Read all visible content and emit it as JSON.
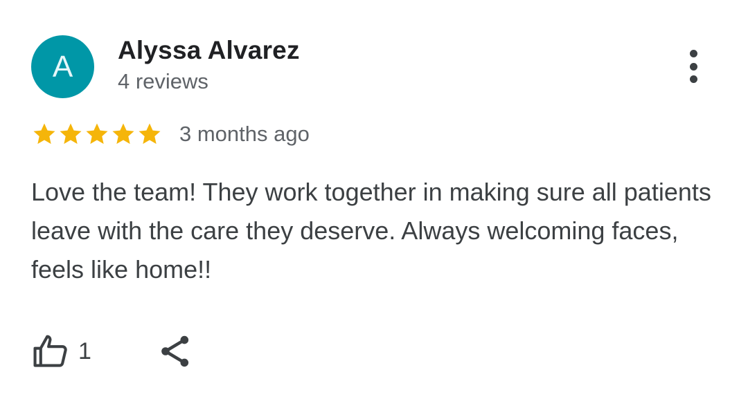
{
  "reviewer": {
    "avatar_initial": "A",
    "avatar_color": "#0097a7",
    "name": "Alyssa Alvarez",
    "review_count": "4 reviews"
  },
  "rating": {
    "stars": 5,
    "max_stars": 5,
    "star_color": "#f5b50a",
    "timestamp": "3 months ago"
  },
  "review": {
    "text": "Love the team! They work together in making sure all patients leave with the care they deserve. Always welcoming faces, feels like home!!"
  },
  "actions": {
    "like_icon": "thumbs-up-icon",
    "like_count": "1",
    "share_icon": "share-icon",
    "more_icon": "more-vertical-icon"
  }
}
